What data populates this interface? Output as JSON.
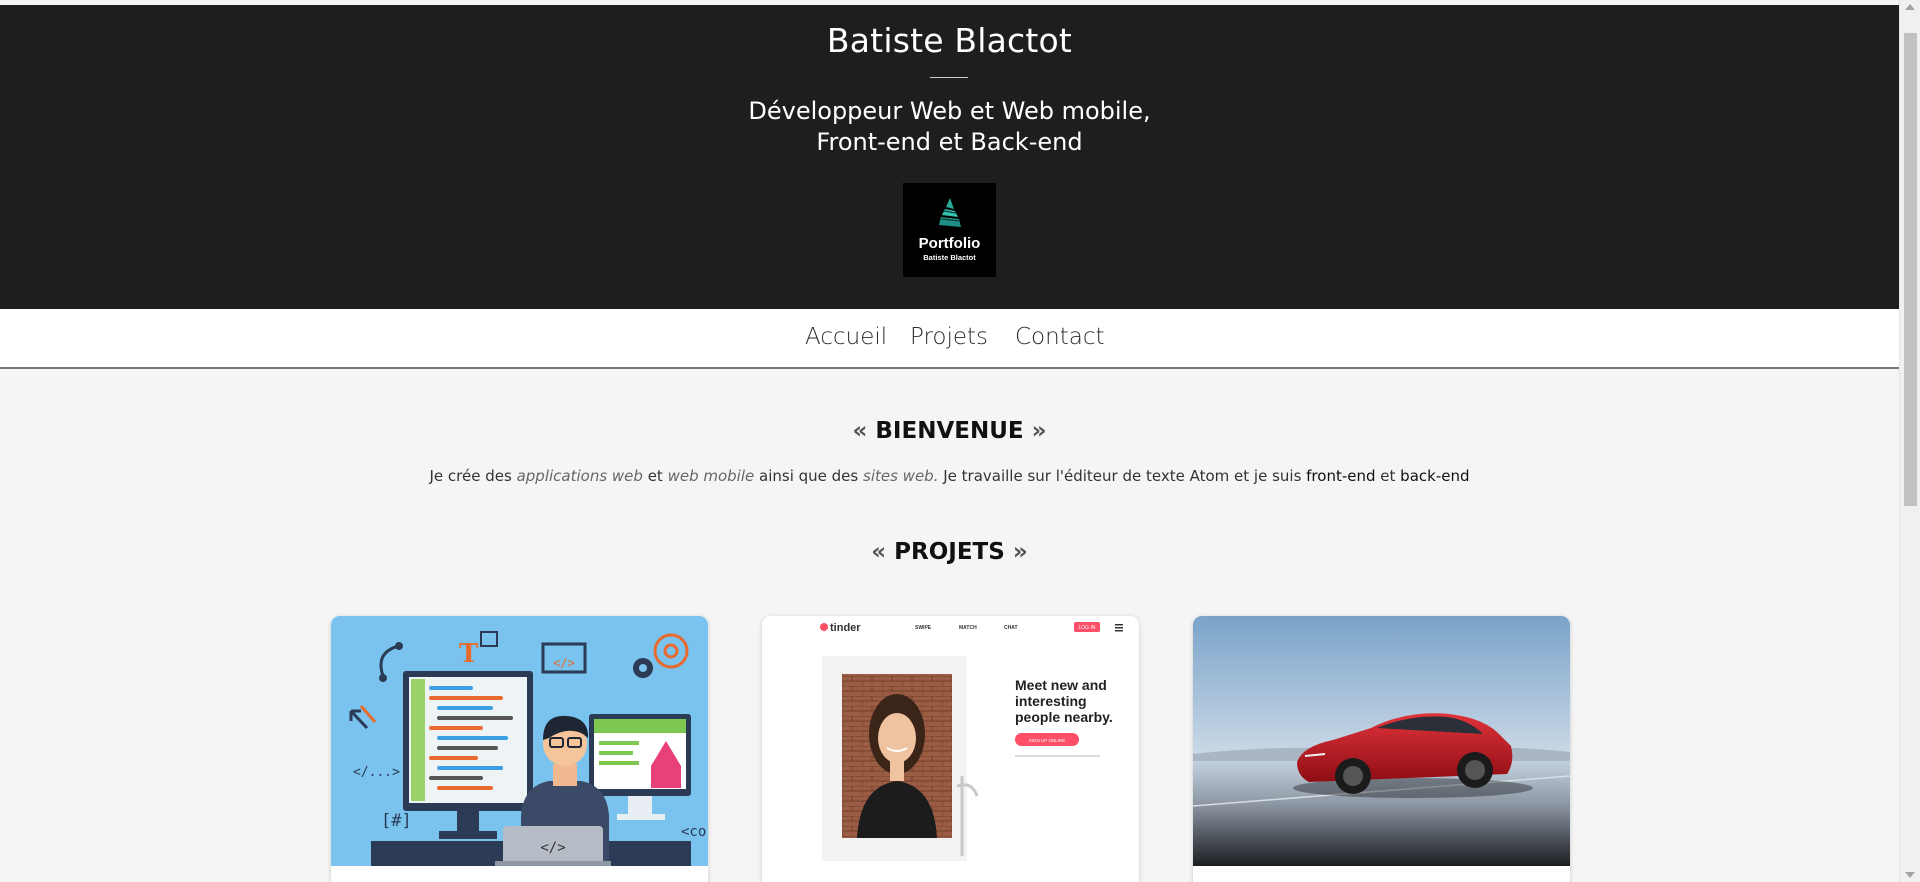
{
  "header": {
    "title": "Batiste Blactot",
    "subtitle_line1": "Développeur Web et Web mobile,",
    "subtitle_line2": "Front-end et Back-end",
    "logo": {
      "title": "Portfolio",
      "subtitle": "Batiste Blactot"
    }
  },
  "nav": {
    "items": [
      "Accueil",
      "Projets",
      "Contact"
    ]
  },
  "welcome": {
    "open_quote": "«",
    "close_quote": "»",
    "title": "BIENVENUE",
    "text": {
      "p1": "Je crée des ",
      "em1": "applications web",
      "p2": " et ",
      "em2": "web mobile",
      "p3": " ainsi que des ",
      "em3": "sites web.",
      "p4": " Je travaille sur l'éditeur de texte Atom et je suis ",
      "strong1": "front-end",
      "p5": " et ",
      "strong2": "back-end"
    }
  },
  "projects": {
    "title": "PROJETS",
    "cards": [
      {
        "icon": "developer-illustration",
        "labels": {
          "t": "T",
          "code": "</...>",
          "hash": "[#]",
          "laptop": "</>",
          "partial": "<co",
          "tag": "</>"
        }
      },
      {
        "icon": "tinder-screenshot",
        "brand": "tinder",
        "menu": [
          "SWIPE",
          "MATCH",
          "CHAT"
        ],
        "login": "LOG IN",
        "headline": [
          "Meet new and",
          "interesting",
          "people nearby."
        ],
        "cta": "SIGN UP ONLINE"
      },
      {
        "icon": "tesla-photo"
      }
    ]
  },
  "colors": {
    "header_bg": "#1e1e1e",
    "page_bg": "#f4f5f4",
    "card1_bg": "#79c3ee",
    "tinder_accent": "#fd5068",
    "car_red": "#c8151e"
  }
}
